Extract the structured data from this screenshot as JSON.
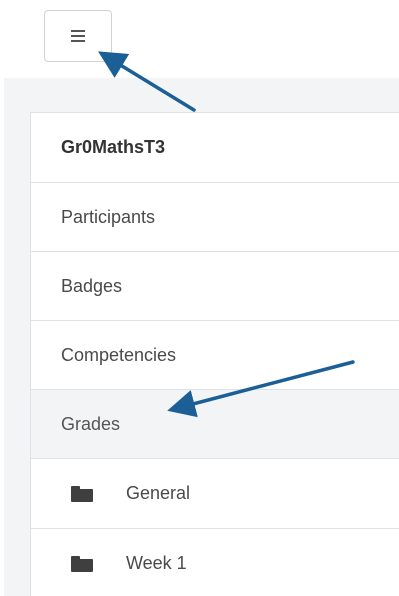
{
  "toggle": {
    "icon": "hamburger-icon"
  },
  "nav": {
    "course": "Gr0MathsT3",
    "items": [
      {
        "label": "Participants"
      },
      {
        "label": "Badges"
      },
      {
        "label": "Competencies"
      },
      {
        "label": "Grades"
      }
    ],
    "sections": [
      {
        "label": "General",
        "icon": "folder-icon"
      },
      {
        "label": "Week 1",
        "icon": "folder-icon"
      }
    ]
  },
  "colors": {
    "annotation_arrow": "#1b5f96",
    "active_background": "#f2f4f6"
  }
}
